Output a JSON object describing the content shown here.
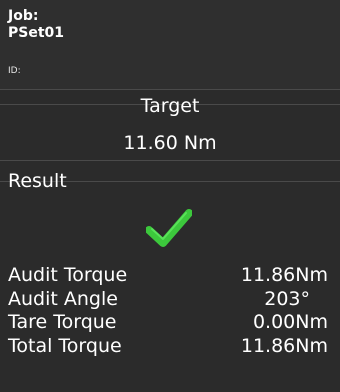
{
  "header": {
    "job_label": "Job:",
    "job_value": "PSet01",
    "id_label": "ID:"
  },
  "target": {
    "title": "Target",
    "value": "11.60 Nm"
  },
  "result": {
    "label": "Result",
    "status_icon": "check-icon",
    "status_color": "#3cc83c",
    "rows": [
      {
        "label": "Audit Torque",
        "value": "11.86Nm"
      },
      {
        "label": "Audit Angle",
        "value": "203°"
      },
      {
        "label": "Tare Torque",
        "value": "0.00Nm"
      },
      {
        "label": "Total Torque",
        "value": "11.86Nm"
      }
    ]
  }
}
